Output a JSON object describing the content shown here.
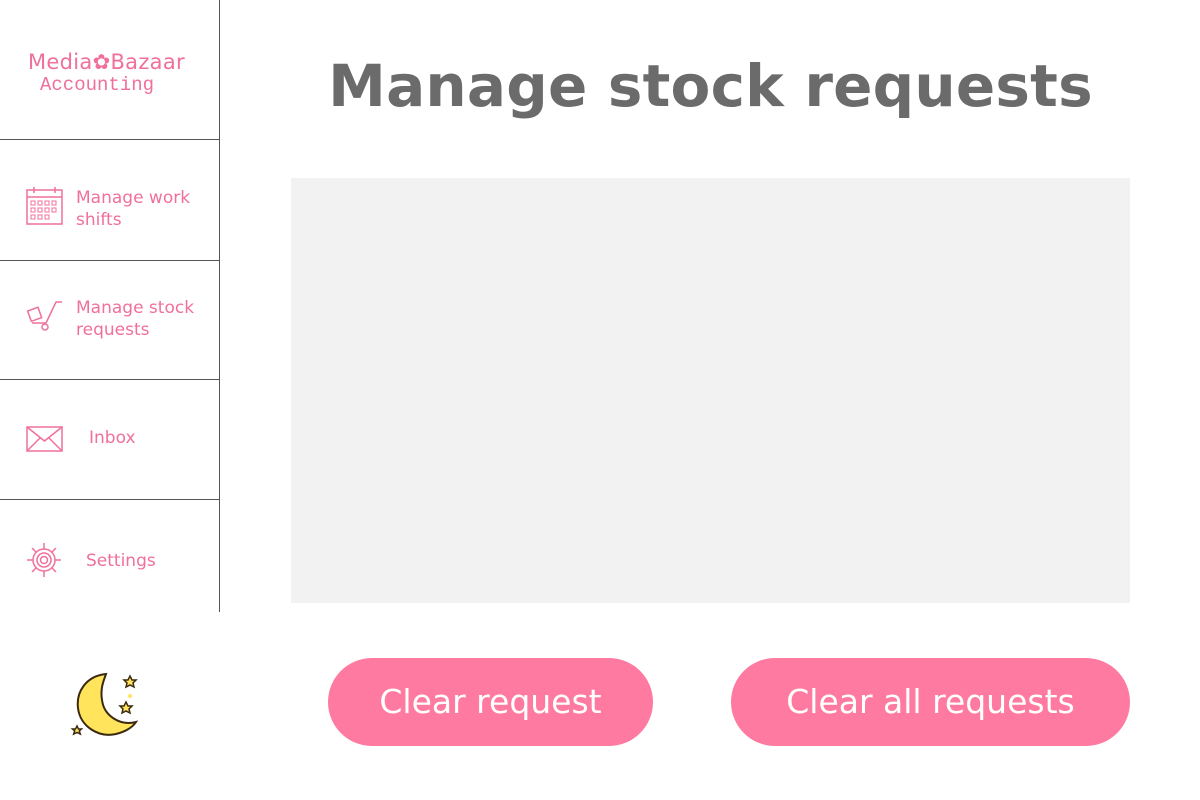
{
  "app": {
    "brand": "Media✿Bazaar",
    "subtitle": "Accounting"
  },
  "sidebar": {
    "items": [
      {
        "label": "Manage work shifts",
        "icon": "calendar-icon"
      },
      {
        "label": "Manage stock requests",
        "icon": "hand-truck-icon"
      },
      {
        "label": "Inbox",
        "icon": "envelope-icon"
      },
      {
        "label": "Settings",
        "icon": "gear-icon"
      }
    ],
    "theme_toggle_icon": "moon-stars-icon"
  },
  "main": {
    "title": "Manage stock requests",
    "buttons": {
      "clear_request": "Clear request",
      "clear_all": "Clear all requests"
    }
  },
  "colors": {
    "accent": "#f0709b",
    "button": "#ff7aa0",
    "title": "#6b6b6b",
    "panel": "#f2f2f2",
    "moon": "#ffe45c"
  }
}
